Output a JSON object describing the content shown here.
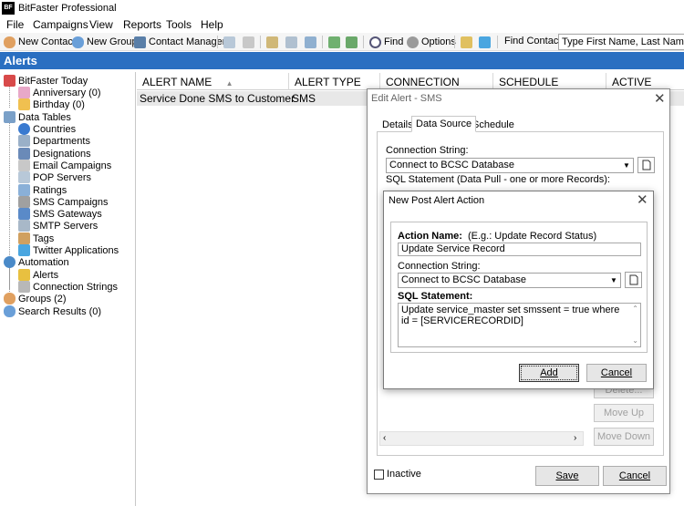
{
  "window": {
    "logo": "BF",
    "title": "BitFaster Professional"
  },
  "menu": [
    "File",
    "Campaigns",
    "View",
    "Reports",
    "Tools",
    "Help"
  ],
  "toolbar": {
    "new_contact": "New Contact",
    "new_group": "New Group",
    "contact_manager": "Contact Manager",
    "find": "Find",
    "options": "Options",
    "find_contact_label": "Find Contact:",
    "find_contact_value": "Type First Name, Last Name or Em"
  },
  "section_title": "Alerts",
  "tree": {
    "today": "BitFaster Today",
    "anniversary": "Anniversary (0)",
    "birthday": "Birthday (0)",
    "data_tables": "Data Tables",
    "countries": "Countries",
    "departments": "Departments",
    "designations": "Designations",
    "email_campaigns": "Email Campaigns",
    "pop_servers": "POP Servers",
    "ratings": "Ratings",
    "sms_campaigns": "SMS Campaigns",
    "sms_gateways": "SMS Gateways",
    "smtp_servers": "SMTP Servers",
    "tags": "Tags",
    "twitter_apps": "Twitter Applications",
    "automation": "Automation",
    "alerts": "Alerts",
    "connection_strings": "Connection Strings",
    "groups": "Groups (2)",
    "search_results": "Search Results (0)"
  },
  "grid": {
    "columns": [
      "ALERT NAME",
      "ALERT TYPE",
      "CONNECTION",
      "SCHEDULE",
      "ACTIVE"
    ],
    "sort_indicator": "▲",
    "rows": [
      {
        "name": "Service Done SMS to Customer",
        "type": "SMS"
      }
    ]
  },
  "edit_dialog": {
    "title": "Edit Alert - SMS",
    "tabs": [
      "Details",
      "Data Source",
      "Schedule"
    ],
    "conn_label": "Connection String:",
    "conn_value": "Connect to BCSC Database",
    "sql_label": "SQL Statement (Data Pull - one or more Records):",
    "delete": "Delete...",
    "move_up": "Move Up",
    "move_down": "Move Down",
    "inactive": "Inactive",
    "save": "Save",
    "cancel": "Cancel"
  },
  "post_dialog": {
    "title": "New Post Alert Action",
    "action_name_label": "Action Name:",
    "action_name_hint": "(E.g.: Update Record Status)",
    "action_name_value": "Update Service Record",
    "conn_label": "Connection String:",
    "conn_value": "Connect to BCSC Database",
    "sql_label": "SQL Statement:",
    "sql_value": "Update service_master set smssent = true where id = [SERVICERECORDID]",
    "add": "Add",
    "cancel": "Cancel"
  },
  "colors": {
    "header_blue": "#2a6fc1",
    "selected_row": "#e8e8e8"
  }
}
